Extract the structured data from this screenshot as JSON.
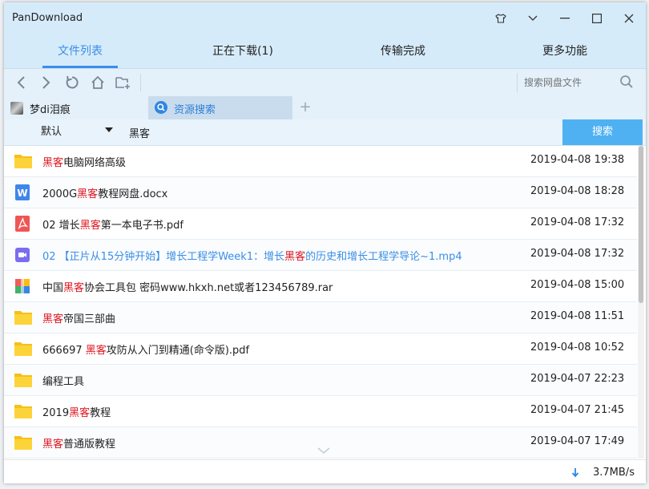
{
  "window": {
    "title": "PanDownload"
  },
  "tabs": [
    {
      "label": "文件列表",
      "active": true
    },
    {
      "label": "正在下载(1)",
      "active": false
    },
    {
      "label": "传输完成",
      "active": false
    },
    {
      "label": "更多功能",
      "active": false
    }
  ],
  "toolbar": {
    "search_placeholder": "搜索网盘文件"
  },
  "account": {
    "name": "梦di泪痕"
  },
  "resource_tab": {
    "label": "资源搜索"
  },
  "filter": {
    "sort_value": "默认",
    "keyword": "黑客",
    "search_label": "搜索"
  },
  "colors": {
    "accent": "#3a8ee6",
    "highlight": "#e0141e",
    "search_button": "#4fb1f2",
    "titlebar": "#d6ebfa"
  },
  "files": [
    {
      "icon": "folder-icon",
      "pre": "",
      "hl": "黑客",
      "post": "电脑网络高级",
      "date": "2019-04-08 19:38"
    },
    {
      "icon": "word-doc-icon",
      "pre": "2000G",
      "hl": "黑客",
      "post": "教程网盘.docx",
      "date": "2019-04-08 18:28"
    },
    {
      "icon": "pdf-icon",
      "pre": "02 增长",
      "hl": "黑客",
      "post": "第一本电子书.pdf",
      "date": "2019-04-08 17:32"
    },
    {
      "icon": "video-icon",
      "pre": "02 【正片从15分钟开始】增长工程学Week1：增长",
      "hl": "黑客",
      "post": "的历史和增长工程学导论~1.mp4",
      "date": "2019-04-08 17:32",
      "link": true
    },
    {
      "icon": "archive-icon",
      "pre": "中国",
      "hl": "黑客",
      "post": "协会工具包 密码www.hkxh.net或者123456789.rar",
      "date": "2019-04-08 15:00"
    },
    {
      "icon": "folder-icon",
      "pre": "",
      "hl": "黑客",
      "post": "帝国三部曲",
      "date": "2019-04-08 11:51"
    },
    {
      "icon": "folder-icon",
      "pre": "666697 ",
      "hl": "黑客",
      "post": "攻防从入门到精通(命令版).pdf",
      "date": "2019-04-08 10:52"
    },
    {
      "icon": "folder-icon",
      "pre": "编程工具",
      "hl": "",
      "post": "",
      "date": "2019-04-07 22:23"
    },
    {
      "icon": "folder-icon",
      "pre": "2019",
      "hl": "黑客",
      "post": "教程",
      "date": "2019-04-07 21:45"
    },
    {
      "icon": "folder-icon",
      "pre": "",
      "hl": "黑客",
      "post": "普通版教程",
      "date": "2019-04-07 17:49"
    }
  ],
  "status": {
    "speed": "3.7MB/s"
  }
}
